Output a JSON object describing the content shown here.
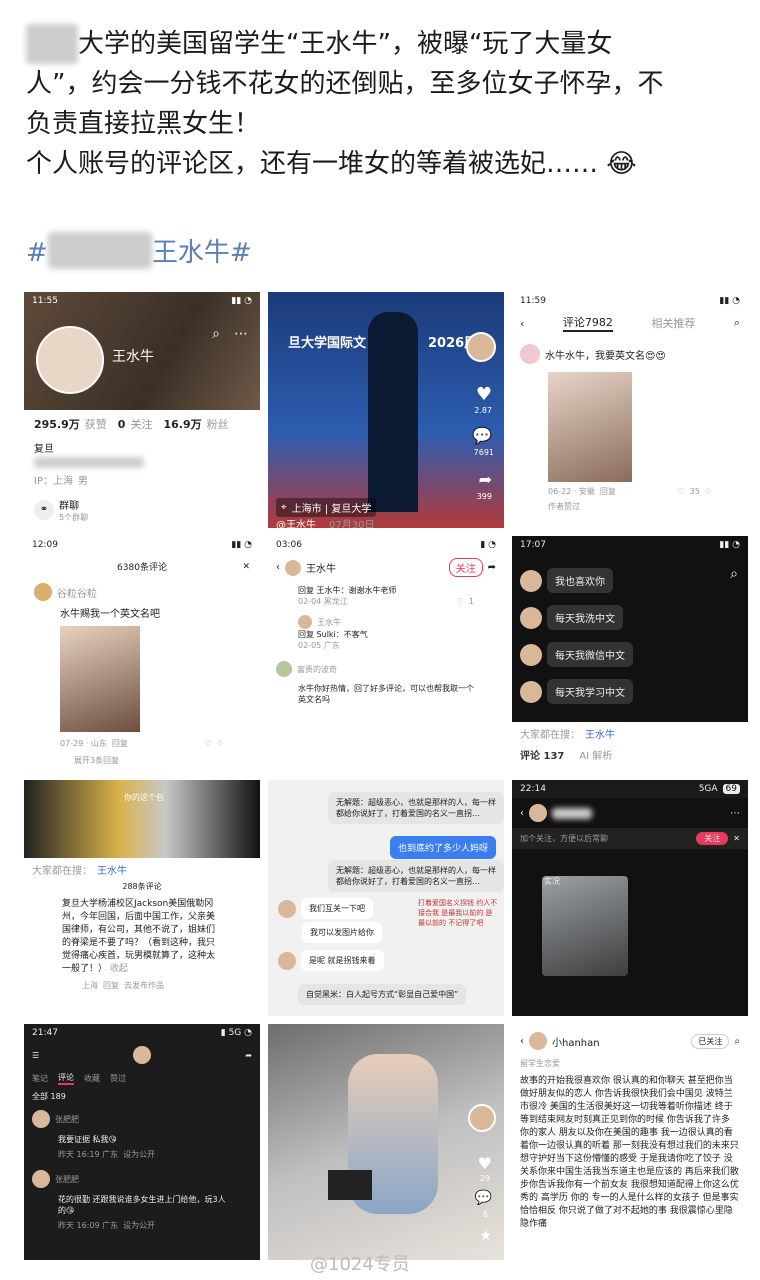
{
  "post": {
    "line1": "大学的美国留学生“王水牛”，被曝“玩了大量女",
    "line2": "人”，约会一分钱不花女的还倒贴，至多位女子怀孕，不",
    "line3": "负责直接拉黑女生！",
    "line4": "个人账号的评论区，还有一堆女的等着被选妃……",
    "emoji": "😂",
    "hashtag_prefix": "#",
    "hashtag_text": "王水牛#"
  },
  "s1": {
    "time": "11:55",
    "name": "王水牛",
    "followers": "295.9万",
    "followers_label": "获赞",
    "following": "0",
    "following_label": "关注",
    "fans": "16.9万",
    "fans_label": "粉丝",
    "school": "复旦",
    "ip": "IP：上海",
    "gender": "男",
    "group": "群聊",
    "group_members": "5个群聊"
  },
  "s2": {
    "banner": "旦大学国际文",
    "year": "2026届",
    "location": "上海市 | 复旦大学",
    "user": "@王水牛",
    "date": "07月30日",
    "likes": "2.87",
    "comments": "7691",
    "shares": "399"
  },
  "s3": {
    "time": "11:59",
    "tab1": "评论7982",
    "tab2": "相关推荐",
    "comment": "水牛水牛，我要英文名😍😍",
    "meta": "06-22 · 安徽",
    "reply": "回复",
    "likes": "35",
    "author_tag": "作者赞过"
  },
  "s4": {
    "time": "12:09",
    "count": "6380条评论",
    "user": "谷粒谷粒",
    "comment": "水牛赐我一个英文名吧",
    "meta": "07-29 · 山东",
    "reply": "回复",
    "expand": "展开3条回复"
  },
  "s5": {
    "time": "03:06",
    "name": "王水牛",
    "follow": "关注",
    "r1": "回复 王水牛：谢谢水牛老师",
    "r1meta": "02-04 黑龙江",
    "r1likes": "1",
    "r2user": "王水牛",
    "r2": "回复 Sulki：不客气",
    "r2meta": "02-05 广东",
    "r3user": "富贵的波奇",
    "r3": "水牛你好热情，回了好多评论，可以也帮我取一个英文名吗"
  },
  "s6": {
    "time": "17:07",
    "m1": "我也喜欢你",
    "m2": "每天我洗中文",
    "m3": "每天我微信中文",
    "m4": "每天我学习中文",
    "search_label": "大家都在搜：",
    "search_term": "王水牛",
    "tab_comment": "评论 137",
    "tab_ai": "AI 解析"
  },
  "s7": {
    "search_label": "大家都在搜：",
    "search_term": "王水牛",
    "count": "288条评论",
    "comment": "复旦大学杨浦校区Jackson美国俄勒冈州，今年回国，后面中国工作，父亲美国律师，有公司，其他不说了，姐妹们的脊梁是不要了吗？（看到这种，我只觉得痛心疾首，玩男模就算了，这种太一般了！）",
    "collapse": "收起",
    "meta": "上海",
    "reply": "回复",
    "fav": "去发布作品",
    "caption": "你的这个包"
  },
  "s8": {
    "m1": "无解题：超级恶心，也就是那样的人，每一样都给你说好了，打着爱国的名义一直拐…",
    "m2": "也到底约了多少人妈呀",
    "m3": "无解题：超级恶心，也就是那样的人，每一样都给你说好了，打着爱国的名义一直拐…",
    "m4": "我们互关一下吧",
    "m5": "我可以发图片给你",
    "m6": "是呢 就是拐钱来着",
    "m7": "自觉黑米：白人起号方式“彰显自己爱中国”",
    "note": "打着爱国名义拐钱 约人不接合我 是最我以前的 是最以前的 不记得了吧"
  },
  "s9": {
    "time": "22:14",
    "signal": "5GA",
    "battery": "69",
    "hint": "加个关注，方便以后常聊",
    "follow": "关注",
    "tag": "实况"
  },
  "s10": {
    "time": "21:47",
    "tabs": [
      "笔记",
      "评论",
      "收藏",
      "赞过"
    ],
    "total": "全部 189",
    "c1user": "张肥肥",
    "c1": "我要证据 私我😘",
    "c1meta": "昨天 16:19 广东",
    "c1reply": "设为公开",
    "c2user": "张肥肥",
    "c2": "花的很勤 还跟我说谁多女生进上门给他，玩3人的😘",
    "c2meta": "昨天 16:09 广东",
    "c2reply": "设为公开"
  },
  "s11": {
    "likes": "29",
    "comments": "6"
  },
  "s12": {
    "name": "小hanhan",
    "follow": "已关注",
    "sub": "留学生恋爱",
    "text": "故事的开始我很喜欢你 很认真的和你聊天 甚至把你当做好朋友似的恋人 你告诉我很快我们会中国见 波特兰市很冷 美国的生活很美好这一切我等着听你描述 终于等到结束网友时刻真正见到你的时候 你告诉我了许多 你的家人 朋友以及你在美国的趣事 我一边很认真的看着你一边很认真的听着 那一刻我没有想过我们的未来只想守护好当下这份懵懂的感受 于是我请你吃了饺子 没关系你来中国生活我当东道主也是应该的 再后来我们散步你告诉我你有一个前女友 我很想知道配得上你这么优秀的 高学历 你的 专一的人是什么样的女孩子 但是事实恰恰相反 你只说了做了对不起她的事 我很震惊心里隐隐作痛"
  },
  "watermark": "@1024专员"
}
